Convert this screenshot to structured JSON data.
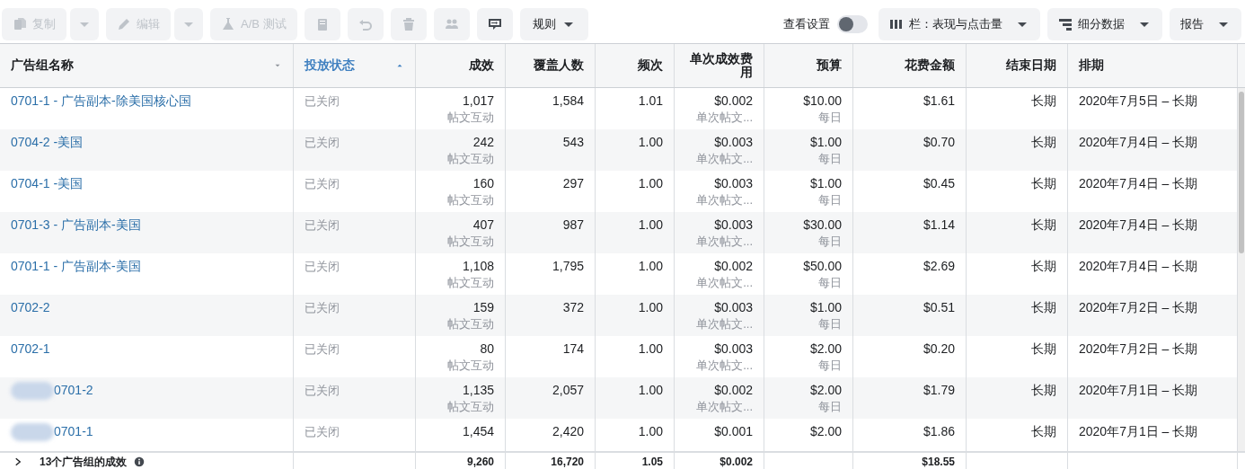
{
  "toolbar": {
    "left": [
      {
        "kind": "split",
        "label": "复制",
        "disabled": true
      },
      {
        "kind": "split",
        "label": "编辑",
        "disabled": true
      },
      {
        "kind": "labeled",
        "label": "A/B 测试",
        "disabled": true
      },
      {
        "kind": "icon",
        "disabled": true
      },
      {
        "kind": "icon",
        "disabled": true
      },
      {
        "kind": "icon",
        "disabled": true
      },
      {
        "kind": "icon",
        "disabled": true
      },
      {
        "kind": "icon",
        "disabled": false
      },
      {
        "kind": "dropdown",
        "label": "规则",
        "disabled": false
      }
    ],
    "view_settings": {
      "label": "查看设置",
      "on": false
    },
    "right": [
      {
        "label": "栏：表现与点击量"
      },
      {
        "label": "细分数据"
      },
      {
        "label": "报告"
      }
    ]
  },
  "table": {
    "columns": [
      {
        "label": "广告组名称",
        "has_menu": true,
        "sorted_ascending": false,
        "selected": false
      },
      {
        "label": "投放状态",
        "has_menu": false,
        "sorted_ascending": true,
        "selected": true
      },
      {
        "label": "成效",
        "selected": false
      },
      {
        "label": "覆盖人数",
        "selected": false
      },
      {
        "label": "频次",
        "selected": false
      },
      {
        "label": "单次成效费用",
        "selected": false
      },
      {
        "label": "预算",
        "selected": false
      },
      {
        "label": "花费金额",
        "selected": false
      },
      {
        "label": "结束日期",
        "selected": false
      },
      {
        "label": "排期",
        "selected": false
      }
    ],
    "rows": [
      {
        "name": "0701-1 - 广告副本-除美国核心国",
        "redacted": false,
        "status": "已关闭",
        "results": "1,017",
        "results_sub": "帖文互动",
        "reach": "1,584",
        "frequency": "1.01",
        "cpr": "$0.002",
        "cpr_sub": "单次帖文...",
        "budget": "$10.00",
        "budget_sub": "每日",
        "spend": "$1.61",
        "end": "长期",
        "schedule": "2020年7月5日 – 长期"
      },
      {
        "name": "0704-2 -美国",
        "redacted": false,
        "status": "已关闭",
        "results": "242",
        "results_sub": "帖文互动",
        "reach": "543",
        "frequency": "1.00",
        "cpr": "$0.003",
        "cpr_sub": "单次帖文...",
        "budget": "$1.00",
        "budget_sub": "每日",
        "spend": "$0.70",
        "end": "长期",
        "schedule": "2020年7月4日 – 长期"
      },
      {
        "name": "0704-1 -美国",
        "redacted": false,
        "status": "已关闭",
        "results": "160",
        "results_sub": "帖文互动",
        "reach": "297",
        "frequency": "1.00",
        "cpr": "$0.003",
        "cpr_sub": "单次帖文...",
        "budget": "$1.00",
        "budget_sub": "每日",
        "spend": "$0.45",
        "end": "长期",
        "schedule": "2020年7月4日 – 长期"
      },
      {
        "name": "0701-3 - 广告副本-美国",
        "redacted": false,
        "status": "已关闭",
        "results": "407",
        "results_sub": "帖文互动",
        "reach": "987",
        "frequency": "1.00",
        "cpr": "$0.003",
        "cpr_sub": "单次帖文...",
        "budget": "$30.00",
        "budget_sub": "每日",
        "spend": "$1.14",
        "end": "长期",
        "schedule": "2020年7月4日 – 长期"
      },
      {
        "name": "0701-1 - 广告副本-美国",
        "redacted": false,
        "status": "已关闭",
        "results": "1,108",
        "results_sub": "帖文互动",
        "reach": "1,795",
        "frequency": "1.00",
        "cpr": "$0.002",
        "cpr_sub": "单次帖文...",
        "budget": "$50.00",
        "budget_sub": "每日",
        "spend": "$2.69",
        "end": "长期",
        "schedule": "2020年7月4日 – 长期"
      },
      {
        "name": "0702-2",
        "redacted": false,
        "status": "已关闭",
        "results": "159",
        "results_sub": "帖文互动",
        "reach": "372",
        "frequency": "1.00",
        "cpr": "$0.003",
        "cpr_sub": "单次帖文...",
        "budget": "$1.00",
        "budget_sub": "每日",
        "spend": "$0.51",
        "end": "长期",
        "schedule": "2020年7月2日 – 长期"
      },
      {
        "name": "0702-1",
        "redacted": false,
        "status": "已关闭",
        "results": "80",
        "results_sub": "帖文互动",
        "reach": "174",
        "frequency": "1.00",
        "cpr": "$0.003",
        "cpr_sub": "单次帖文...",
        "budget": "$2.00",
        "budget_sub": "每日",
        "spend": "$0.20",
        "end": "长期",
        "schedule": "2020年7月2日 – 长期"
      },
      {
        "name": "0701-2",
        "redacted": true,
        "status": "已关闭",
        "results": "1,135",
        "results_sub": "帖文互动",
        "reach": "2,057",
        "frequency": "1.00",
        "cpr": "$0.002",
        "cpr_sub": "单次帖文...",
        "budget": "$2.00",
        "budget_sub": "每日",
        "spend": "$1.79",
        "end": "长期",
        "schedule": "2020年7月1日 – 长期"
      },
      {
        "name": "0701-1",
        "redacted": true,
        "status": "已关闭",
        "results": "1,454",
        "reach": "2,420",
        "frequency": "1.00",
        "cpr": "$0.001",
        "budget": "$2.00",
        "spend": "$1.86",
        "end": "长期",
        "schedule": "2020年7月1日 – 长期"
      }
    ],
    "summary": {
      "label": "13个广告组的成效",
      "results": "9,260",
      "reach": "16,720",
      "frequency": "1.05",
      "cpr": "$0.002",
      "spend": "$18.55"
    }
  }
}
